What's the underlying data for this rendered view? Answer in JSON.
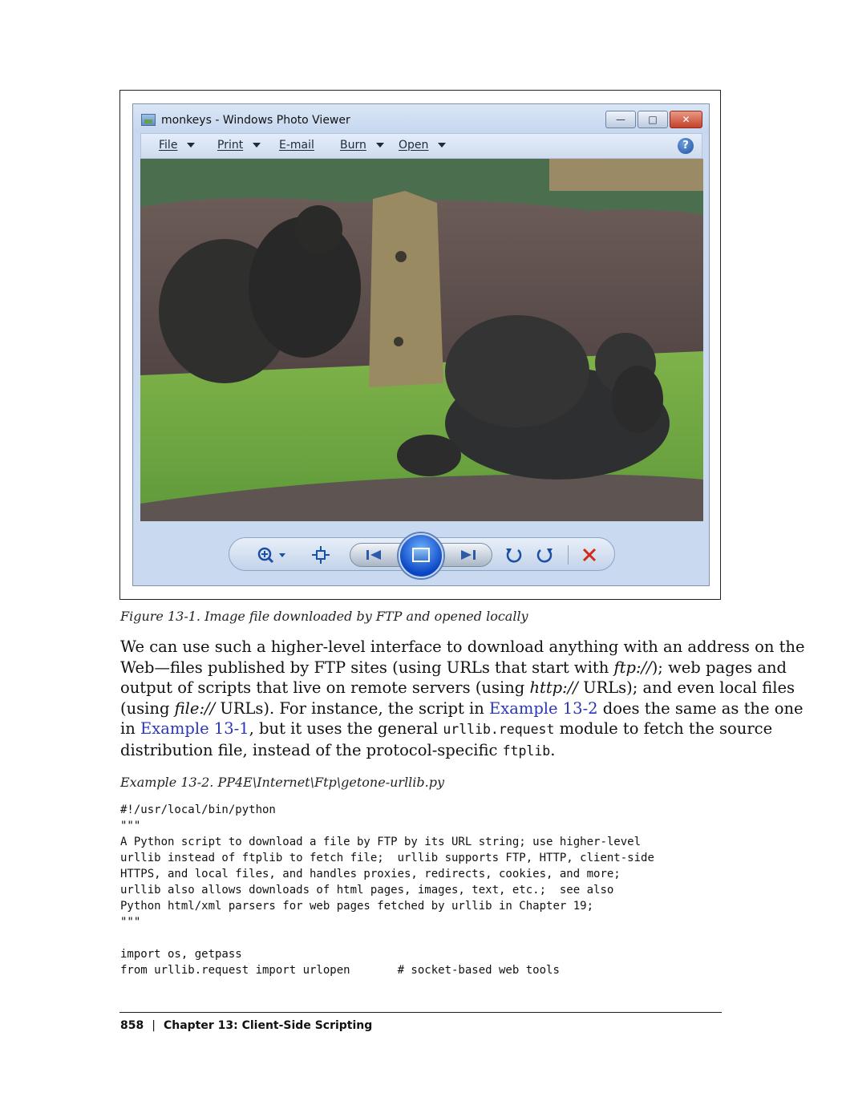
{
  "figure": {
    "window": {
      "title": "monkeys - Windows Photo Viewer",
      "minimize": "—",
      "maximize": "□",
      "close": "✕",
      "menu": [
        {
          "label": "File",
          "has_dropdown": true
        },
        {
          "label": "Print",
          "has_dropdown": true
        },
        {
          "label": "E-mail",
          "has_dropdown": false
        },
        {
          "label": "Burn",
          "has_dropdown": true
        },
        {
          "label": "Open",
          "has_dropdown": true
        }
      ],
      "help": "?",
      "controls": [
        "zoom-icon",
        "actual-size-icon",
        "previous-icon",
        "slideshow-icon",
        "next-icon",
        "rotate-counterclockwise-icon",
        "rotate-clockwise-icon",
        "delete-icon"
      ]
    },
    "caption": "Figure 13-1. Image file downloaded by FTP and opened locally"
  },
  "body": {
    "lines": [
      {
        "parts": [
          {
            "t": "We can use such a higher-level interface to download anything with an address on the"
          }
        ]
      },
      {
        "parts": [
          {
            "t": "Web—files published by FTP sites (using URLs that start with "
          },
          {
            "t": "ftp://",
            "style": "italic"
          },
          {
            "t": "); web pages and"
          }
        ]
      },
      {
        "parts": [
          {
            "t": "output of scripts that live on remote servers (using "
          },
          {
            "t": "http://",
            "style": "italic"
          },
          {
            "t": " URLs); and even local files"
          }
        ]
      },
      {
        "parts": [
          {
            "t": "("
          },
          {
            "t": "using "
          },
          {
            "t": "file://",
            "style": "italic"
          },
          {
            "t": " URLs). For instance, the script in "
          },
          {
            "t": "Example 13-2",
            "style": "link"
          },
          {
            "t": " does the same as the one"
          }
        ]
      },
      {
        "parts": [
          {
            "t": "in "
          },
          {
            "t": "Example 13-1",
            "style": "link"
          },
          {
            "t": ", but it uses the general "
          },
          {
            "t": "urllib.request",
            "style": "mono"
          },
          {
            "t": " module to fetch the source"
          }
        ]
      },
      {
        "parts": [
          {
            "t": "distribution file, instead of the protocol-specific "
          },
          {
            "t": "ftplib",
            "style": "mono"
          },
          {
            "t": "."
          }
        ]
      }
    ]
  },
  "example": {
    "title": "Example 13-2. PP4E\\Internet\\Ftp\\getone-urllib.py",
    "code": "#!/usr/local/bin/python\n\"\"\"\nA Python script to download a file by FTP by its URL string; use higher-level\nurllib instead of ftplib to fetch file;  urllib supports FTP, HTTP, client-side\nHTTPS, and local files, and handles proxies, redirects, cookies, and more;\nurllib also allows downloads of html pages, images, text, etc.;  see also\nPython html/xml parsers for web pages fetched by urllib in Chapter 19;\n\"\"\"\n\nimport os, getpass\nfrom urllib.request import urlopen       # socket-based web tools"
  },
  "footer": {
    "page_number": "858",
    "separator": "|",
    "chapter": "Chapter 13:  Client-Side Scripting"
  }
}
